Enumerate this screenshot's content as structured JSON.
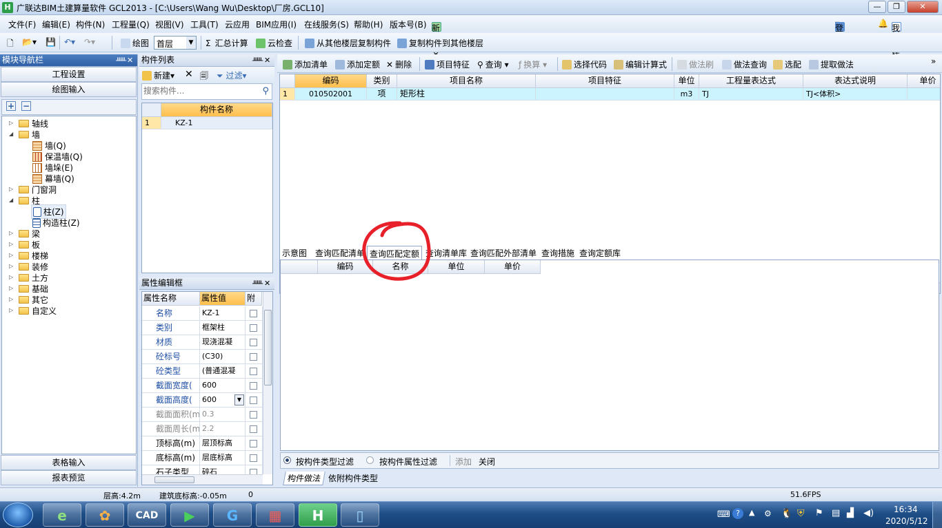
{
  "window": {
    "title": "广联达BIM土建算量软件 GCL2013 - [C:\\Users\\Wang Wu\\Desktop\\厂房.GCL10]"
  },
  "menu": [
    "文件(F)",
    "编辑(E)",
    "构件(N)",
    "工程量(Q)",
    "视图(V)",
    "工具(T)",
    "云应用",
    "BIM应用(I)",
    "在线服务(S)",
    "帮助(H)",
    "版本号(B)",
    "新建变更"
  ],
  "menu_right": {
    "login": "登录",
    "suggest": "我要建议"
  },
  "toolbar": {
    "draw": "绘图",
    "floor": "首层",
    "sum": "汇总计算",
    "cloud_check": "云检查",
    "copy_from": "从其他楼层复制构件",
    "copy_to": "复制构件到其他楼层"
  },
  "nav": {
    "title": "模块导航栏",
    "project_settings": "工程设置",
    "drawing_input": "绘图输入",
    "table_input": "表格输入",
    "report_preview": "报表预览",
    "tree": [
      "轴线",
      "墙",
      "墙(Q)",
      "保温墙(Q)",
      "墙垛(E)",
      "幕墙(Q)",
      "门窗洞",
      "柱",
      "柱(Z)",
      "构造柱(Z)",
      "梁",
      "板",
      "楼梯",
      "装修",
      "土方",
      "基础",
      "其它",
      "自定义"
    ]
  },
  "component_list": {
    "title": "构件列表",
    "new": "新建",
    "filter": "过滤",
    "search_placeholder": "搜索构件...",
    "col_name": "构件名称",
    "rows": [
      {
        "n": "1",
        "name": "KZ-1"
      }
    ]
  },
  "props": {
    "title": "属性编辑框",
    "col_name": "属性名称",
    "col_value": "属性值",
    "col_extra": "附加",
    "rows": [
      {
        "name": "名称",
        "value": "KZ-1"
      },
      {
        "name": "类别",
        "value": "框架柱"
      },
      {
        "name": "材质",
        "value": "现浇混凝"
      },
      {
        "name": "砼标号",
        "value": "(C30)"
      },
      {
        "name": "砼类型",
        "value": "(普通混凝"
      },
      {
        "name": "截面宽度(",
        "value": "600"
      },
      {
        "name": "截面高度(",
        "value": "600"
      },
      {
        "name": "截面面积(m",
        "value": "0.3"
      },
      {
        "name": "截面周长(m",
        "value": "2.2"
      },
      {
        "name": "顶标高(m)",
        "value": "层顶标高"
      },
      {
        "name": "底标高(m)",
        "value": "层底标高"
      },
      {
        "name": "石子类型",
        "value": "碎石"
      }
    ]
  },
  "right_toolbar": [
    "添加清单",
    "添加定额",
    "删除",
    "项目特征",
    "查询",
    "换算",
    "选择代码",
    "编辑计算式",
    "做法刷",
    "做法查询",
    "选配",
    "提取做法"
  ],
  "upper_grid": {
    "headers": [
      "编码",
      "类别",
      "项目名称",
      "项目特征",
      "单位",
      "工程量表达式",
      "表达式说明",
      "单价"
    ],
    "rows": [
      {
        "n": "1",
        "code": "010502001",
        "type": "项",
        "name": "矩形柱",
        "feature": "",
        "unit": "m3",
        "expr": "TJ",
        "desc": "TJ<体积>"
      }
    ]
  },
  "lower_tabs": [
    "示意图",
    "查询匹配清单",
    "查询匹配定额",
    "查询清单库",
    "查询匹配外部清单",
    "查询措施",
    "查询定额库"
  ],
  "lower_grid": {
    "headers": [
      "编码",
      "名称",
      "单位",
      "单价"
    ]
  },
  "filter_bar": {
    "by_type": "按构件类型过滤",
    "by_attr": "按构件属性过滤",
    "add": "添加",
    "close": "关闭"
  },
  "bottom_tabs": [
    "构件做法",
    "依附构件类型"
  ],
  "status": {
    "floor_height": "层高:4.2m",
    "base_elev": "建筑底标高:-0.05m",
    "zero": "0",
    "fps": "51.6FPS"
  },
  "taskbar": {
    "time": "16:34",
    "date": "2020/5/12"
  },
  "colors": {
    "highlight_col": "#ffcc66",
    "selected_row": "#ccf4ff",
    "annotation_circle": "#e8202a"
  }
}
